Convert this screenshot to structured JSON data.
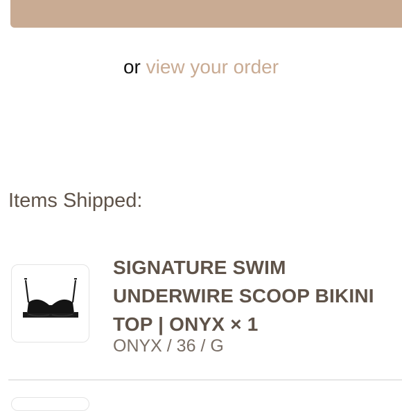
{
  "order_link": {
    "prefix": "or",
    "link_text": "view your order"
  },
  "section": {
    "title": "Items Shipped:"
  },
  "items": [
    {
      "title": "SIGNATURE SWIM UNDERWIRE SCOOP BIKINI TOP | ONYX × 1",
      "variant": "ONYX / 36 / G",
      "image_icon": "bikini-top-icon"
    }
  ],
  "colors": {
    "accent": "#c9ab93",
    "text_brown": "#5f5349",
    "text_muted": "#7a6f66",
    "divider": "#e6e6e6"
  }
}
